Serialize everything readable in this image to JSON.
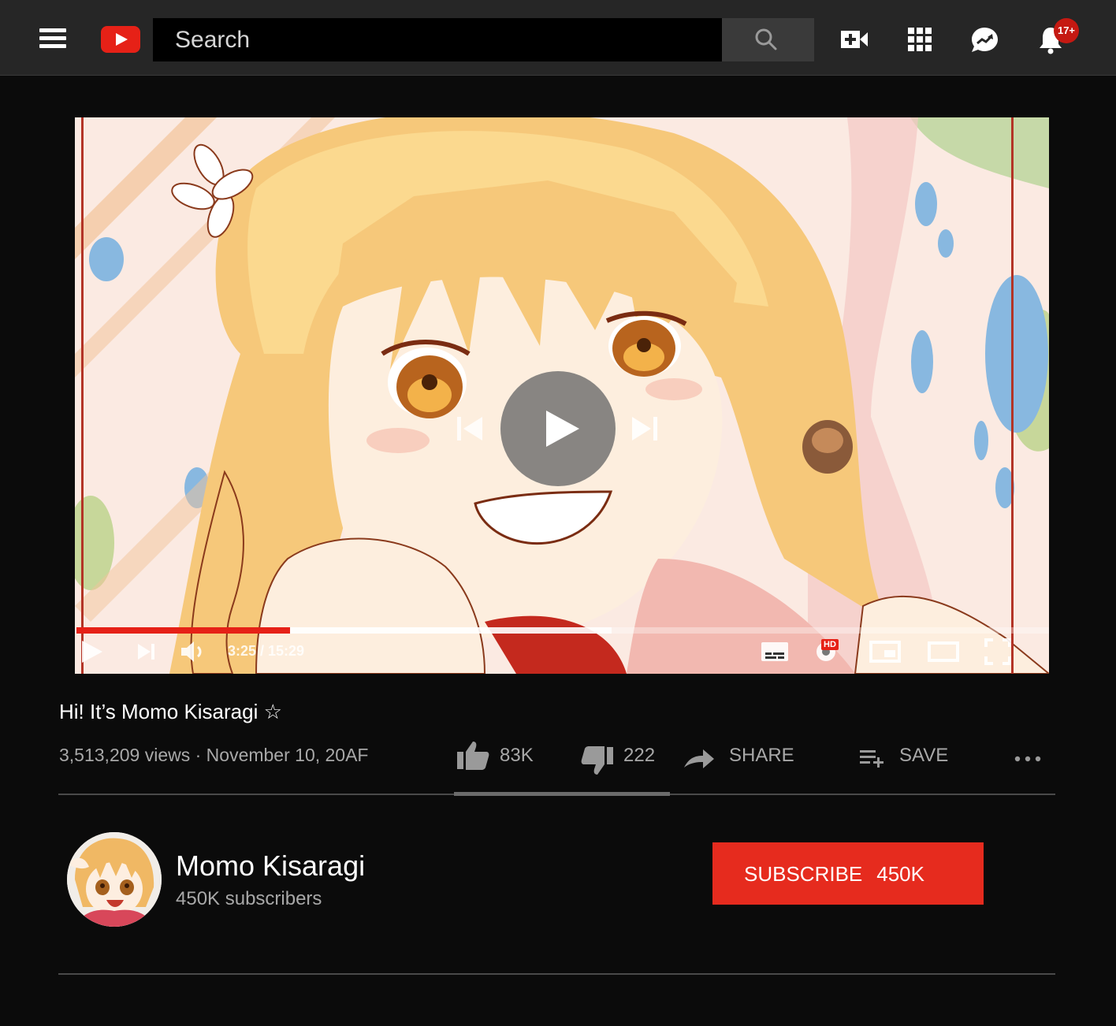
{
  "header": {
    "search_placeholder": "Search",
    "notification_count": "17+",
    "icons": [
      "menu-icon",
      "youtube-logo",
      "search-icon",
      "video-camera-plus-icon",
      "apps-grid-icon",
      "messages-icon",
      "bell-icon"
    ]
  },
  "player": {
    "time": "3:25 / 15:29",
    "progress": 0.22,
    "buffered": 0.55,
    "hd_label": "HD",
    "accent": "#e62117"
  },
  "video": {
    "title": "Hi! It’s Momo Kisaragi ☆",
    "meta": "3,513,209 views · November 10, 20AF",
    "likes": "83K",
    "dislikes": "222",
    "share_label": "SHARE",
    "save_label": "SAVE"
  },
  "channel": {
    "name": "Momo Kisaragi",
    "subscribers": "450K subscribers",
    "subscribe_label": "SUBSCRIBE",
    "subscribe_count": "450K",
    "subscribe_color": "#e62b1e"
  }
}
